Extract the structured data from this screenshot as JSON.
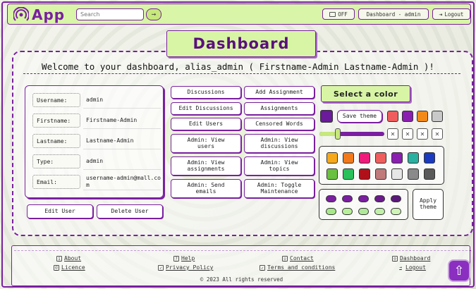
{
  "header": {
    "app_name": "App",
    "search_placeholder": "Search",
    "search_go": "⇝",
    "toggle_label": "OFF",
    "user_label": "Dashboard - admin",
    "logout_label": "Logout"
  },
  "page": {
    "title": "Dashboard",
    "welcome": "Welcome to your dashboard, alias_admin ( Firstname-Admin Lastname-Admin )!"
  },
  "user_info": {
    "rows": [
      {
        "label": "Username:",
        "value": "admin"
      },
      {
        "label": "Firstname:",
        "value": "Firstname-Admin"
      },
      {
        "label": "Lastname:",
        "value": "Lastname-Admin"
      },
      {
        "label": "Type:",
        "value": "admin"
      },
      {
        "label": "Email:",
        "value": "username-admin@mall.com"
      }
    ],
    "edit_user": "Edit User",
    "delete_user": "Delete User"
  },
  "actions": {
    "discussions": "Discussions",
    "add_assignment": "Add Assignment",
    "edit_discussions": "Edit Discussions",
    "assignments": "Assignments",
    "edit_users": "Edit Users",
    "censored_words": "Censored Words",
    "view_users": "Admin: View users",
    "view_discussions": "Admin: View discussions",
    "view_assignments": "Admin: View assignments",
    "view_topics": "Admin: View topics",
    "send_emails": "Admin: Send emails",
    "toggle_maintenance": "Admin: Toggle Maintenance"
  },
  "theme": {
    "title": "Select a color",
    "save_label": "Save theme",
    "apply_label": "Apply theme",
    "current_color": "#6a1a9a",
    "top_swatches": [
      "#ef5d5d",
      "#8a1fb0",
      "#f28a1a",
      "#c9c9c9"
    ],
    "slider_value": 0.28,
    "x_label": "✕",
    "grid_row1": [
      "#f5a81a",
      "#f27a1a",
      "#ef1a7a",
      "#ef5d5d",
      "#8a1fb0",
      "#2ab0a0",
      "#1a3ac0"
    ],
    "grid_row2": [
      "#6ac040",
      "#2ac05a",
      "#b0101a",
      "#c07a7a",
      "#e6e6e6",
      "#8a8a8a",
      "#5a5a5a"
    ],
    "pill_row1": [
      "#7a1fa0",
      "#7a1fa0",
      "#7a1fa0",
      "#6a1a8a",
      "#5a1a7a"
    ],
    "pill_row2": [
      "#a8e88a",
      "#b8f09a",
      "#b0e89a",
      "#c0f0a8",
      "#d0f4b8"
    ]
  },
  "footer": {
    "about": "About",
    "help": "Help",
    "contact": "Contact",
    "dashboard": "Dashboard",
    "licence": "Licence",
    "privacy": "Privacy Policy",
    "terms": "Terms and conditions",
    "logout": "Logout",
    "copyright": "© 2023 All rights reserved",
    "up_glyph": "⇧"
  }
}
